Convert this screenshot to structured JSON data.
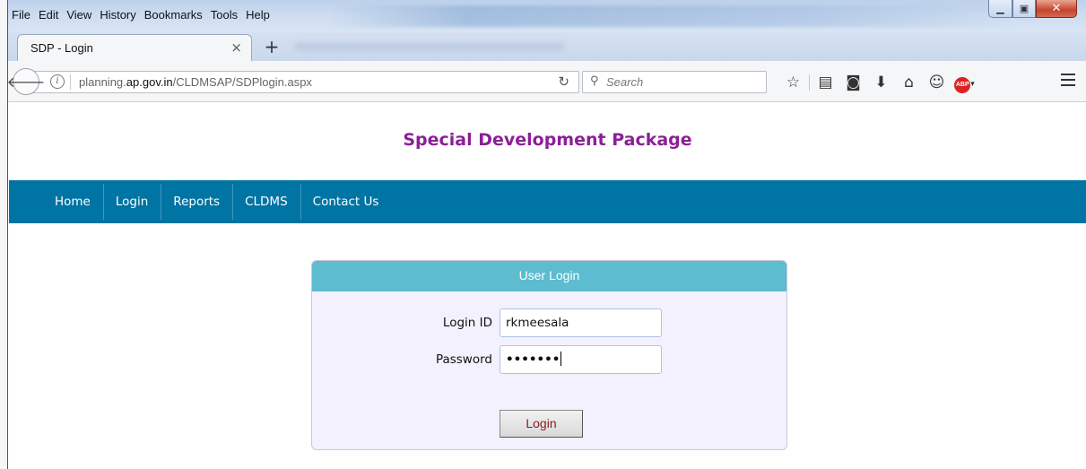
{
  "browser": {
    "menu": [
      "File",
      "Edit",
      "View",
      "History",
      "Bookmarks",
      "Tools",
      "Help"
    ],
    "tab_title": "SDP - Login",
    "url_prefix": "planning.",
    "url_domain": "ap.gov.in",
    "url_path": "/CLDMSAP/SDPlogin.aspx",
    "search_placeholder": "Search"
  },
  "site": {
    "title": "Special Development Package",
    "nav": [
      "Home",
      "Login",
      "Reports",
      "CLDMS",
      "Contact Us"
    ]
  },
  "login": {
    "header": "User Login",
    "login_id_label": "Login ID",
    "login_id_value": "rkmeesala",
    "password_label": "Password",
    "password_mask": "•••••••",
    "button_label": "Login"
  }
}
